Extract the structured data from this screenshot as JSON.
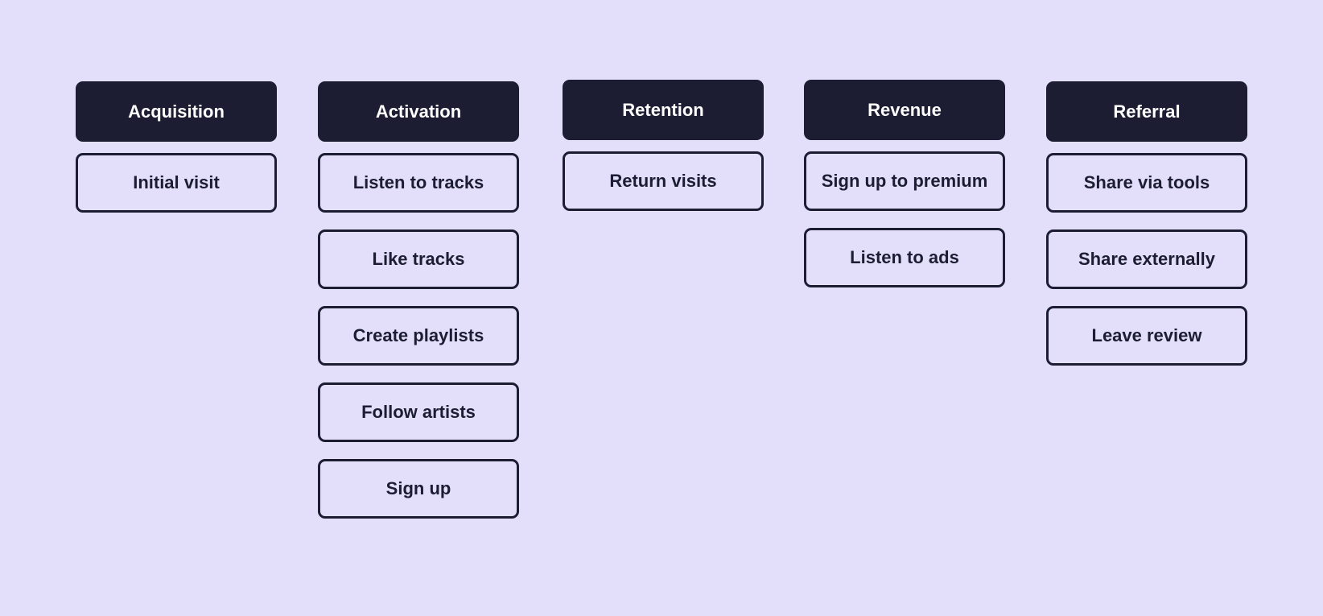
{
  "colors": {
    "background": "#e3dffb",
    "header_fill": "#1c1d33",
    "header_text": "#ffffff",
    "item_border": "#1c1d33",
    "item_text": "#1c1d33"
  },
  "stages": [
    {
      "title": "Acquisition",
      "items": [
        "Initial visit"
      ]
    },
    {
      "title": "Activation",
      "items": [
        "Listen to tracks",
        "Like tracks",
        "Create playlists",
        "Follow artists",
        "Sign up"
      ]
    },
    {
      "title": "Retention",
      "items": [
        "Return visits"
      ]
    },
    {
      "title": "Revenue",
      "items": [
        "Sign up to premium",
        "Listen to ads"
      ]
    },
    {
      "title": "Referral",
      "items": [
        "Share via tools",
        "Share externally",
        "Leave review"
      ]
    }
  ]
}
